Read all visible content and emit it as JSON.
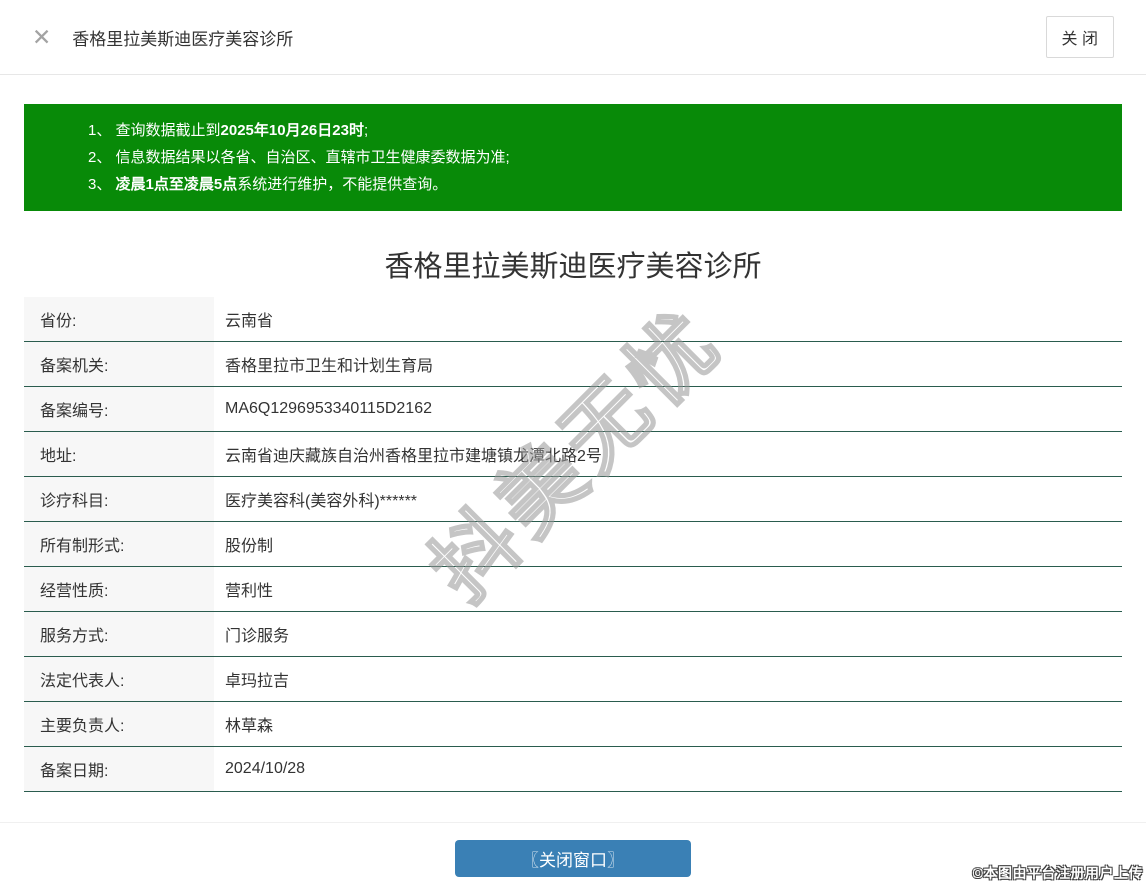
{
  "colors": {
    "banner_green": "#088a08",
    "row_border": "#2a5c4e",
    "button_blue": "#3a80b5"
  },
  "header": {
    "close_icon": "✕",
    "title": "香格里拉美斯迪医疗美容诊所",
    "close_button": "关 闭"
  },
  "notice": {
    "lines": [
      {
        "pre": "1、 查询数据截止到",
        "bold": "2025年10月26日23时",
        "post": ";"
      },
      {
        "pre": "2、 信息数据结果以各省、自治区、直辖市卫生健康委数据为准;",
        "bold": "",
        "post": ""
      },
      {
        "pre": "3、 ",
        "bold": "凌晨1点至凌晨5点",
        "post": "系统进行维护，不能提供查询。"
      }
    ]
  },
  "main": {
    "title": "香格里拉美斯迪医疗美容诊所"
  },
  "table": {
    "rows": [
      {
        "label": "省份:",
        "value": "云南省"
      },
      {
        "label": "备案机关:",
        "value": "香格里拉市卫生和计划生育局"
      },
      {
        "label": "备案编号:",
        "value": "MA6Q1296953340115D2162"
      },
      {
        "label": "地址:",
        "value": "云南省迪庆藏族自治州香格里拉市建塘镇龙潭北路2号"
      },
      {
        "label": "诊疗科目:",
        "value": "医疗美容科(美容外科)******"
      },
      {
        "label": "所有制形式:",
        "value": "股份制"
      },
      {
        "label": "经营性质:",
        "value": "营利性"
      },
      {
        "label": "服务方式:",
        "value": "门诊服务"
      },
      {
        "label": "法定代表人:",
        "value": "卓玛拉吉"
      },
      {
        "label": "主要负责人:",
        "value": "林草森"
      },
      {
        "label": "备案日期:",
        "value": "2024/10/28"
      }
    ]
  },
  "footer": {
    "close_window_button": "〖关闭窗口〗"
  },
  "watermark": {
    "text": "抖美无忧",
    "copyright": "©本图由平台注册用户上传"
  }
}
